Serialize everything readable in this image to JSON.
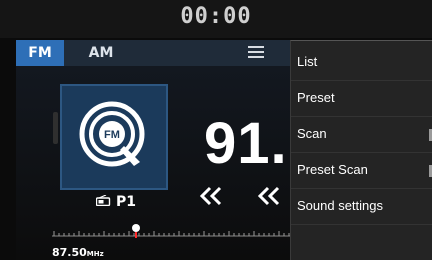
{
  "status": {
    "clock": "00:00"
  },
  "tabs": [
    {
      "label": "FM",
      "active": true
    },
    {
      "label": "AM",
      "active": false
    }
  ],
  "station": {
    "frequency": "91.",
    "preset": "P1",
    "art_text": "FM"
  },
  "tuner": {
    "low_value": "87.50",
    "unit": "MHz"
  },
  "menu": {
    "items": [
      {
        "label": "List"
      },
      {
        "label": "Preset"
      },
      {
        "label": "Scan"
      },
      {
        "label": "Preset Scan"
      },
      {
        "label": "Sound settings"
      }
    ]
  },
  "colors": {
    "accent": "#2e6fb7",
    "art_bg": "#1b3a5b",
    "menu_bg": "#242424"
  }
}
